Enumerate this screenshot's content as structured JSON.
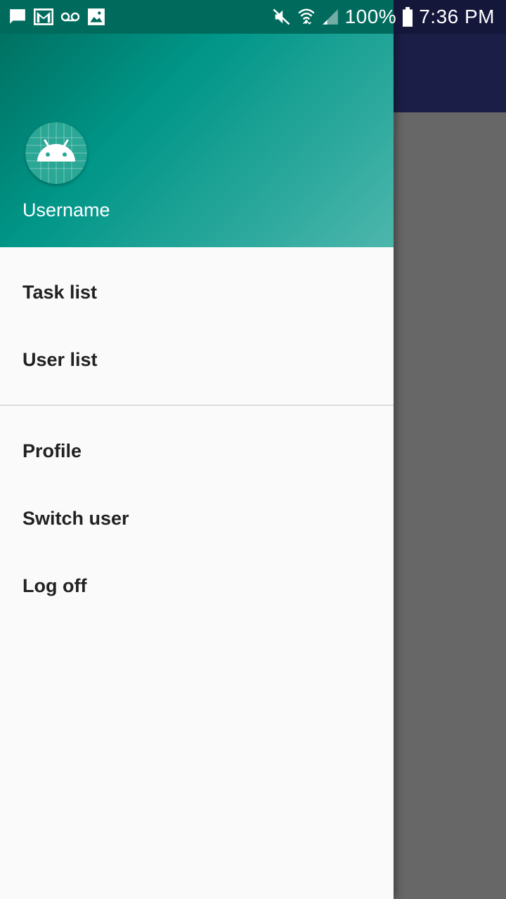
{
  "status_bar": {
    "battery_text": "100%",
    "time": "7:36 PM",
    "left_icons": [
      "message-icon",
      "gmail-icon",
      "voicemail-icon",
      "image-icon"
    ],
    "right_icons": [
      "mute-icon",
      "wifi-icon",
      "signal-icon",
      "battery-icon"
    ]
  },
  "drawer": {
    "header": {
      "username": "Username",
      "avatar_icon": "android-icon"
    },
    "primary_items": [
      {
        "label": "Task list"
      },
      {
        "label": "User list"
      }
    ],
    "secondary_items": [
      {
        "label": "Profile"
      },
      {
        "label": "Switch user"
      },
      {
        "label": "Log off"
      }
    ]
  },
  "colors": {
    "header_start": "#006b5c",
    "header_end": "#4db6ac",
    "app_toolbar": "#1b1f48",
    "scrim": "#676767",
    "menu_text": "#212121"
  }
}
